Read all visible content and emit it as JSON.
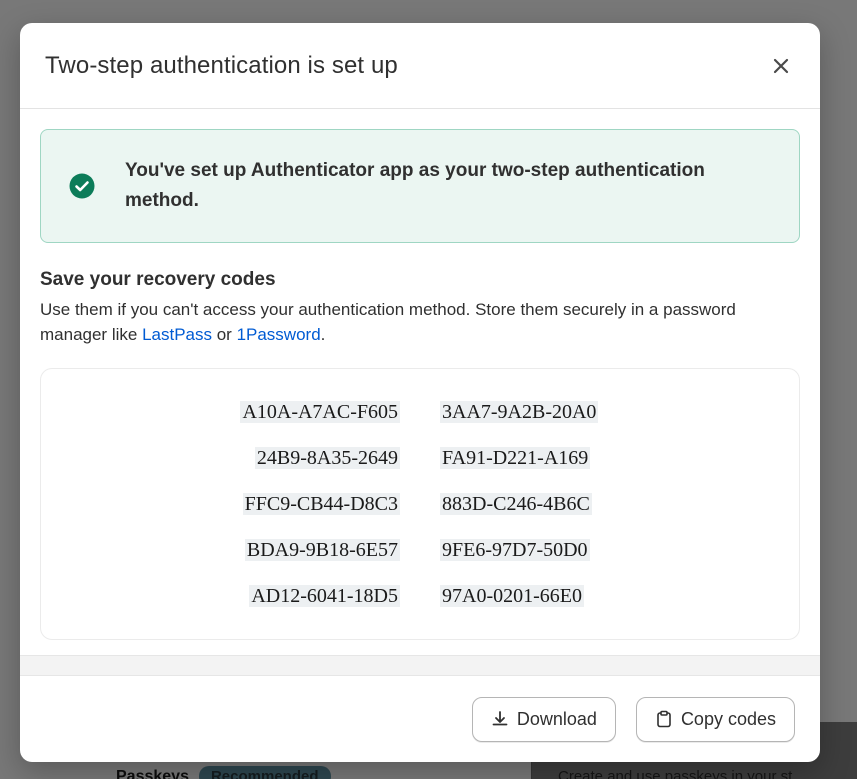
{
  "background": {
    "passkeys_label": "Passkeys",
    "recommended_badge": "Recommended",
    "right_snippet": "Create and use passkeys in your st"
  },
  "modal": {
    "title": "Two-step authentication is set up",
    "close_icon": "close-icon",
    "banner": {
      "icon": "check-circle-icon",
      "text": "You've set up Authenticator app as your two-step authentication method.",
      "accent_color": "#0c7c59"
    },
    "recovery": {
      "heading": "Save your recovery codes",
      "description_before": "Use them if you can't access your authentication method. Store them securely in a password manager like ",
      "link1": "LastPass",
      "description_middle": " or ",
      "link2": "1Password",
      "description_after": ".",
      "codes": [
        [
          "A10A-A7AC-F605",
          "3AA7-9A2B-20A0"
        ],
        [
          "24B9-8A35-2649",
          "FA91-D221-A169"
        ],
        [
          "FFC9-CB44-D8C3",
          "883D-C246-4B6C"
        ],
        [
          "BDA9-9B18-6E57",
          "9FE6-97D7-50D0"
        ],
        [
          "AD12-6041-18D5",
          "97A0-0201-66E0"
        ]
      ]
    },
    "footer": {
      "download_label": "Download",
      "download_icon": "download-icon",
      "copy_label": "Copy codes",
      "copy_icon": "clipboard-icon"
    }
  }
}
